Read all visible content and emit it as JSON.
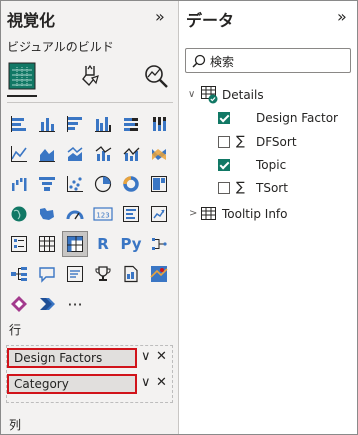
{
  "viz_pane": {
    "title": "視覚化",
    "collapse_glyph": "»",
    "subtitle": "ビジュアルのビルド",
    "rows_label": "行",
    "cols_label": "列",
    "more_glyph": "···",
    "text_icons": {
      "r": "R",
      "py": "Py"
    },
    "fields": [
      {
        "label": "Design Factors"
      },
      {
        "label": "Category"
      }
    ],
    "field_dropdown_glyph": "∨",
    "field_remove_glyph": "✕"
  },
  "data_pane": {
    "title": "データ",
    "collapse_glyph": "»",
    "search_placeholder": "検索",
    "tables": [
      {
        "name": "Details",
        "expanded": true,
        "fields": [
          {
            "name": "Design Factor",
            "checked": true,
            "sum": false
          },
          {
            "name": "DFSort",
            "checked": false,
            "sum": true
          },
          {
            "name": "Topic",
            "checked": true,
            "sum": false
          },
          {
            "name": "TSort",
            "checked": false,
            "sum": true
          }
        ]
      },
      {
        "name": "Tooltip Info",
        "expanded": false
      }
    ]
  },
  "colors": {
    "accent_green": "#117865",
    "highlight_red": "#d1131a",
    "viz_blue": "#3a76c4"
  }
}
